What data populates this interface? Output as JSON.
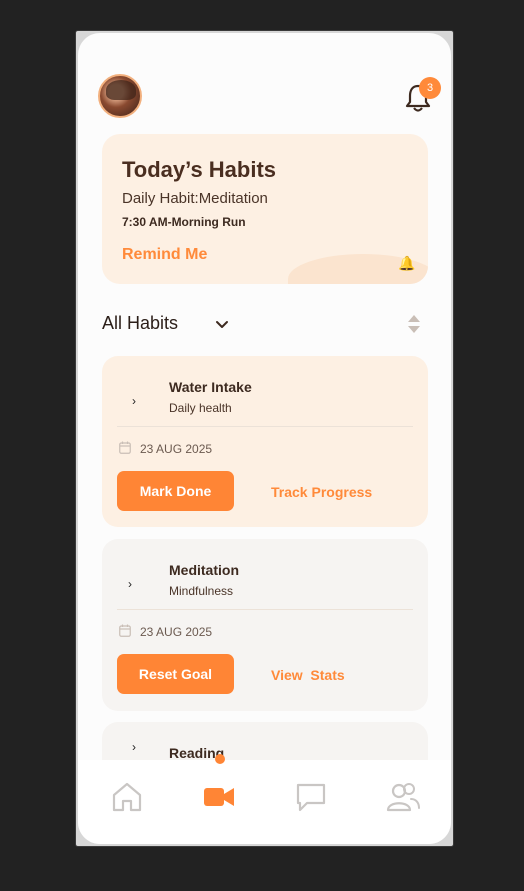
{
  "header": {
    "avatar_icon": "user-avatar",
    "notification_icon": "bell-icon",
    "notification_count": "3"
  },
  "hero": {
    "title": "Today’s Habits",
    "daily_habit": "Daily Habit:Meditation",
    "schedule": "7:30 AM-Morning Run",
    "remind_label": "Remind Me",
    "mini_icon": "bell-icon"
  },
  "filter": {
    "label": "All Habits",
    "dropdown_icon": "chevron-down-icon",
    "sort_icon": "sort-icon"
  },
  "habits": [
    {
      "name": "Water Intake",
      "category": "Daily health",
      "date": "23 AUG 2025",
      "primary_label": "Mark Done",
      "secondary_label": "Track Progress"
    },
    {
      "name": "Meditation",
      "category": "Mindfulness",
      "date": "23 AUG 2025",
      "primary_label": "Reset Goal",
      "secondary_label": "View  Stats"
    },
    {
      "name": "Reading"
    }
  ],
  "tabbar": {
    "items": [
      {
        "icon": "home-icon"
      },
      {
        "icon": "video-icon"
      },
      {
        "icon": "chat-icon"
      },
      {
        "icon": "users-icon"
      }
    ],
    "active_index": 1
  },
  "colors": {
    "accent": "#ff8535",
    "hero_bg": "#fdf0e3",
    "card_bg": "#f6f4f2",
    "text_dark": "#3d2a20"
  }
}
